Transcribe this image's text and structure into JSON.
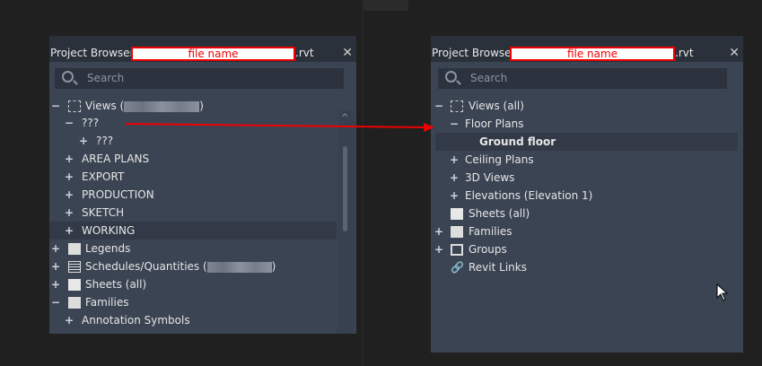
{
  "left_panel": {
    "title": "Project Browser -",
    "file_name": "file name",
    "ext": ".rvt",
    "search_placeholder": "Search",
    "items": [
      {
        "label": "Views (",
        "suffix": ")",
        "toggle": "−"
      },
      {
        "label": "???",
        "toggle": "−"
      },
      {
        "label": "???",
        "toggle": "+"
      },
      {
        "label": "AREA PLANS",
        "toggle": "+"
      },
      {
        "label": "EXPORT",
        "toggle": "+"
      },
      {
        "label": "PRODUCTION",
        "toggle": "+"
      },
      {
        "label": "SKETCH",
        "toggle": "+"
      },
      {
        "label": "WORKING",
        "toggle": "+"
      },
      {
        "label": "Legends",
        "toggle": "+"
      },
      {
        "label": "Schedules/Quantities (",
        "suffix": ")",
        "toggle": "+"
      },
      {
        "label": "Sheets (all)",
        "toggle": "+"
      },
      {
        "label": "Families",
        "toggle": "−"
      },
      {
        "label": "Annotation Symbols",
        "toggle": "+"
      }
    ]
  },
  "right_panel": {
    "title": "Project Browser -",
    "file_name": "file name",
    "ext": ".rvt",
    "search_placeholder": "Search",
    "items": [
      {
        "label": "Views (all)",
        "toggle": "−"
      },
      {
        "label": "Floor Plans",
        "toggle": "−"
      },
      {
        "label": "Ground floor"
      },
      {
        "label": "Ceiling Plans",
        "toggle": "+"
      },
      {
        "label": "3D Views",
        "toggle": "+"
      },
      {
        "label": "Elevations (Elevation 1)",
        "toggle": "+"
      },
      {
        "label": "Sheets (all)"
      },
      {
        "label": "Families",
        "toggle": "+"
      },
      {
        "label": "Groups",
        "toggle": "+"
      },
      {
        "label": "Revit Links"
      }
    ]
  },
  "colors": {
    "annotation": "#e00000",
    "panel": "#3b4453"
  }
}
